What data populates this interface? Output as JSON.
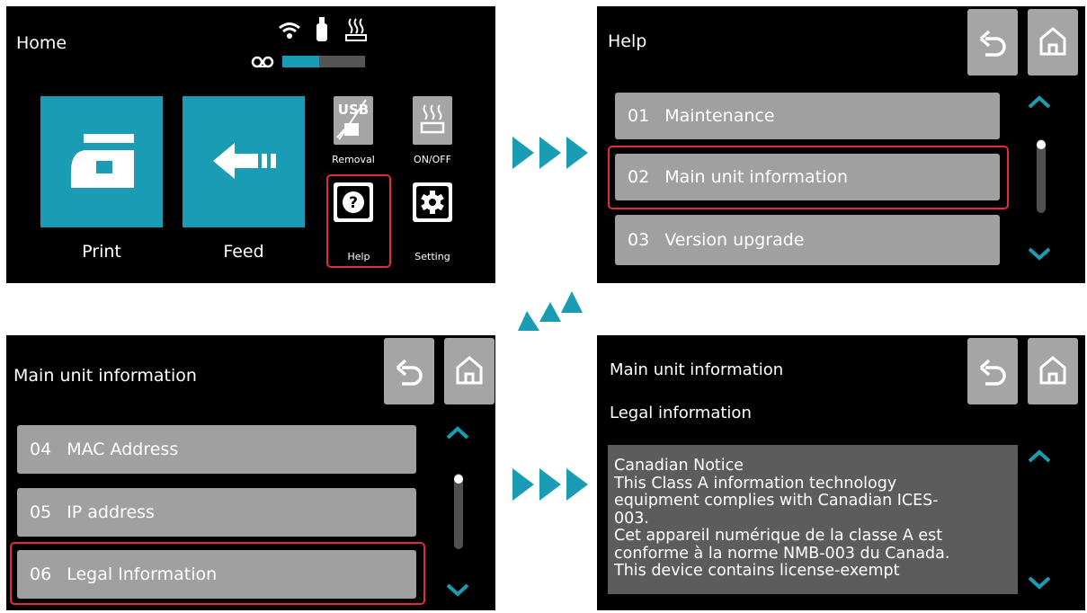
{
  "screen1": {
    "title": "Home",
    "tiles": [
      {
        "label": "Print"
      },
      {
        "label": "Feed"
      }
    ],
    "small_buttons": [
      {
        "label": "Removal",
        "badge": "USB"
      },
      {
        "label": "ON/OFF"
      },
      {
        "label": "Help"
      },
      {
        "label": "Setting"
      }
    ],
    "status_icons": [
      "wifi-icon",
      "usb-drive-icon",
      "heater-icon",
      "ribbon-icon"
    ],
    "ribbon_level": 0.45,
    "colors": {
      "accent": "#1a9cb5",
      "highlight": "#e52b3a"
    }
  },
  "screen2": {
    "title": "Help",
    "items": [
      {
        "num": "01",
        "label": "Maintenance"
      },
      {
        "num": "02",
        "label": "Main unit information"
      },
      {
        "num": "03",
        "label": "Version upgrade"
      }
    ]
  },
  "screen3": {
    "title": "Main unit information",
    "items": [
      {
        "num": "04",
        "label": "MAC Address"
      },
      {
        "num": "05",
        "label": "IP address"
      },
      {
        "num": "06",
        "label": "Legal Information"
      }
    ]
  },
  "screen4": {
    "title": "Main unit information",
    "subtitle": "Legal information",
    "text_lines": [
      "Canadian Notice",
      "This Class A information technology",
      "equipment complies with Canadian ICES-",
      "003.",
      "Cet appareil numérique de la classe A est",
      "conforme à la norme NMB-003 du Canada.",
      "This device contains license-exempt"
    ]
  }
}
